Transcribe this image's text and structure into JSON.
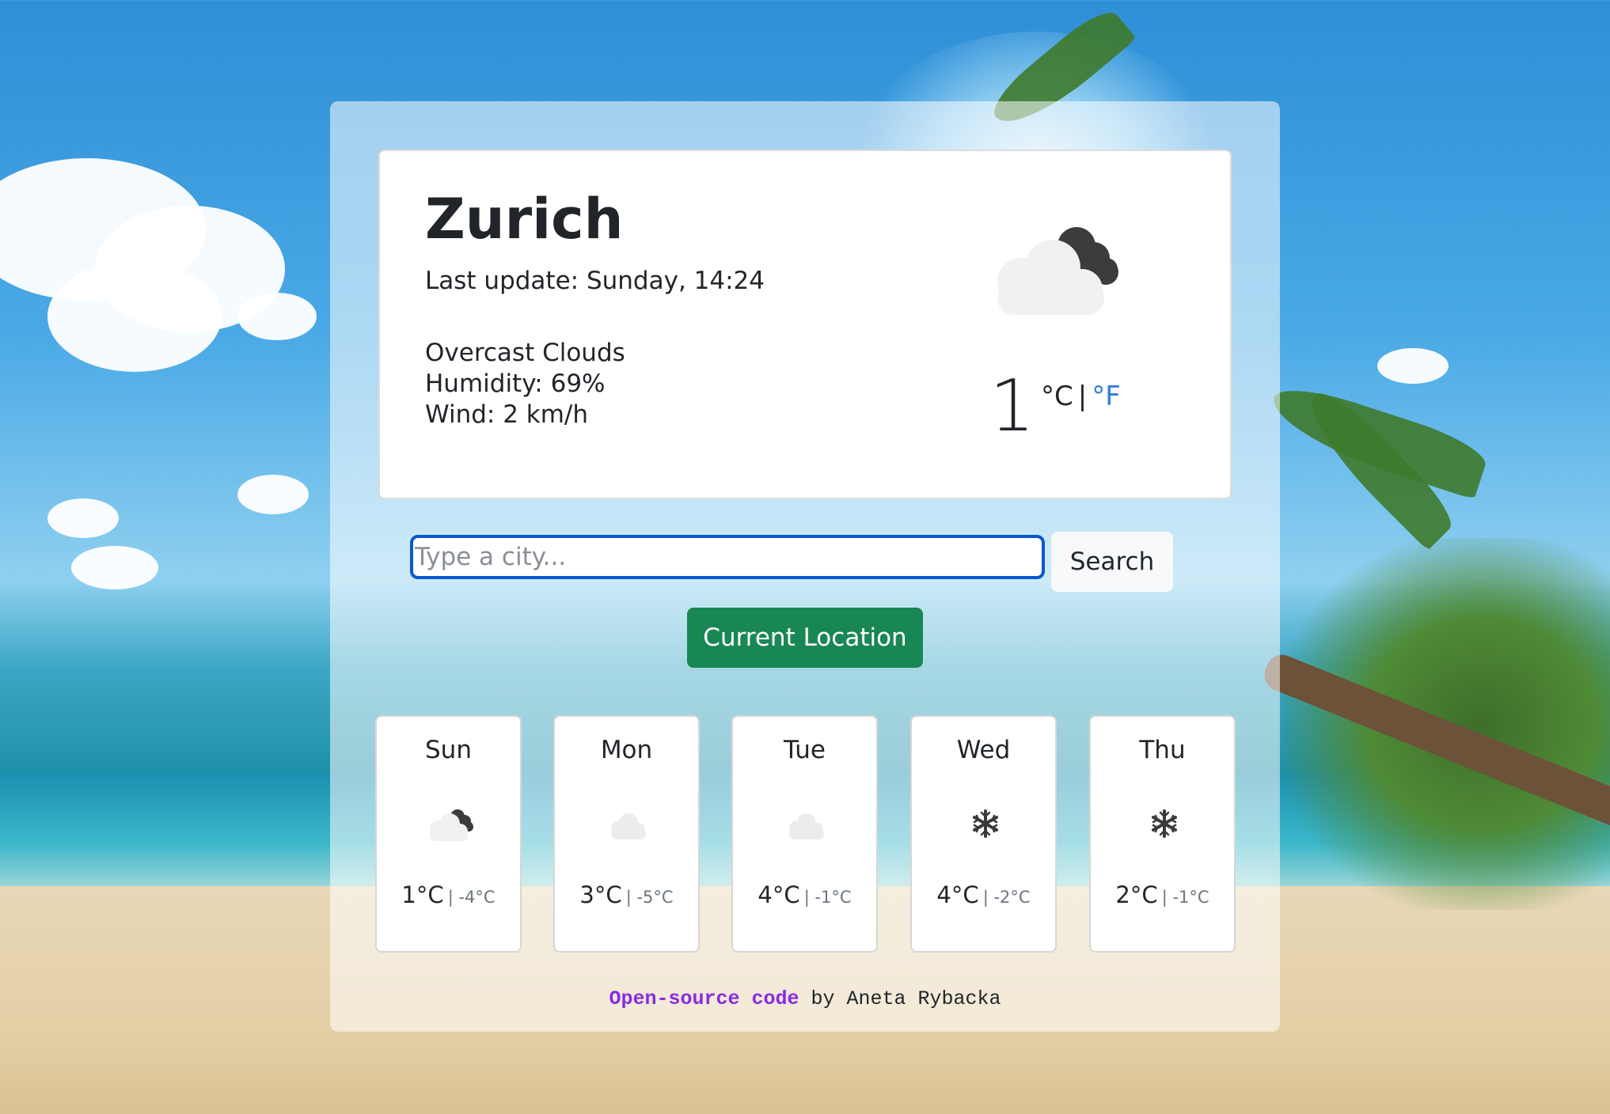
{
  "weather": {
    "city": "Zurich",
    "last_update": "Last update: Sunday, 14:24",
    "description": "Overcast Clouds",
    "humidity": "Humidity: 69%",
    "wind": "Wind: 2 km/h",
    "temperature": "1",
    "unit_celsius": "°C",
    "unit_separator": "|",
    "unit_fahrenheit": "°F",
    "icon": "broken-clouds-icon"
  },
  "search": {
    "placeholder": "Type a city...",
    "value": "",
    "button_label": "Search"
  },
  "location_button": "Current Location",
  "forecast": [
    {
      "day": "Sun",
      "max": "1°C",
      "min": "| -4°C",
      "icon": "broken-clouds-icon"
    },
    {
      "day": "Mon",
      "max": "3°C",
      "min": "| -5°C",
      "icon": "cloud-icon"
    },
    {
      "day": "Tue",
      "max": "4°C",
      "min": "| -1°C",
      "icon": "cloud-icon"
    },
    {
      "day": "Wed",
      "max": "4°C",
      "min": "| -2°C",
      "icon": "snowflake-icon"
    },
    {
      "day": "Thu",
      "max": "2°C",
      "min": "| -1°C",
      "icon": "snowflake-icon"
    }
  ],
  "footer": {
    "link_text": "Open-source code",
    "text": " by Aneta Rybacka"
  },
  "colors": {
    "link_blue": "#2f7de1",
    "button_green": "#198754",
    "footer_link": "#8a2be2",
    "input_border": "#0b57d0"
  }
}
